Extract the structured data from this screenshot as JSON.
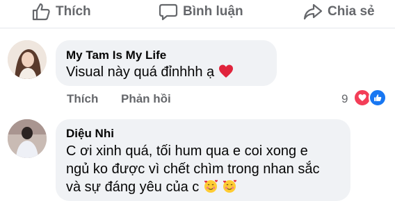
{
  "actions": {
    "like_label": "Thích",
    "comment_label": "Bình luận",
    "share_label": "Chia sẻ"
  },
  "comments": [
    {
      "author": "My Tam Is My Life",
      "text": "Visual này quá đỉnhhh ạ",
      "trailing_emoji": "red-heart-icon",
      "like_label": "Thích",
      "reply_label": "Phản hồi",
      "reaction_count": "9",
      "reactions": [
        "love-reaction-icon",
        "like-reaction-icon"
      ]
    },
    {
      "author": "Diệu Nhi",
      "lines": [
        "C ơi xinh quá, tối hum qua e coi xong e",
        "ngủ ko được vì chết chìm trong nhan sắc",
        "và sự đáng yêu của c"
      ],
      "trailing_emojis": [
        "smiling-face-with-hearts-icon",
        "smiling-face-with-hearts-icon"
      ]
    }
  ],
  "colors": {
    "bubble_bg": "#f0f2f5",
    "meta_text": "#65676b",
    "love_red": "#f33e58",
    "like_blue": "#1877f2"
  }
}
